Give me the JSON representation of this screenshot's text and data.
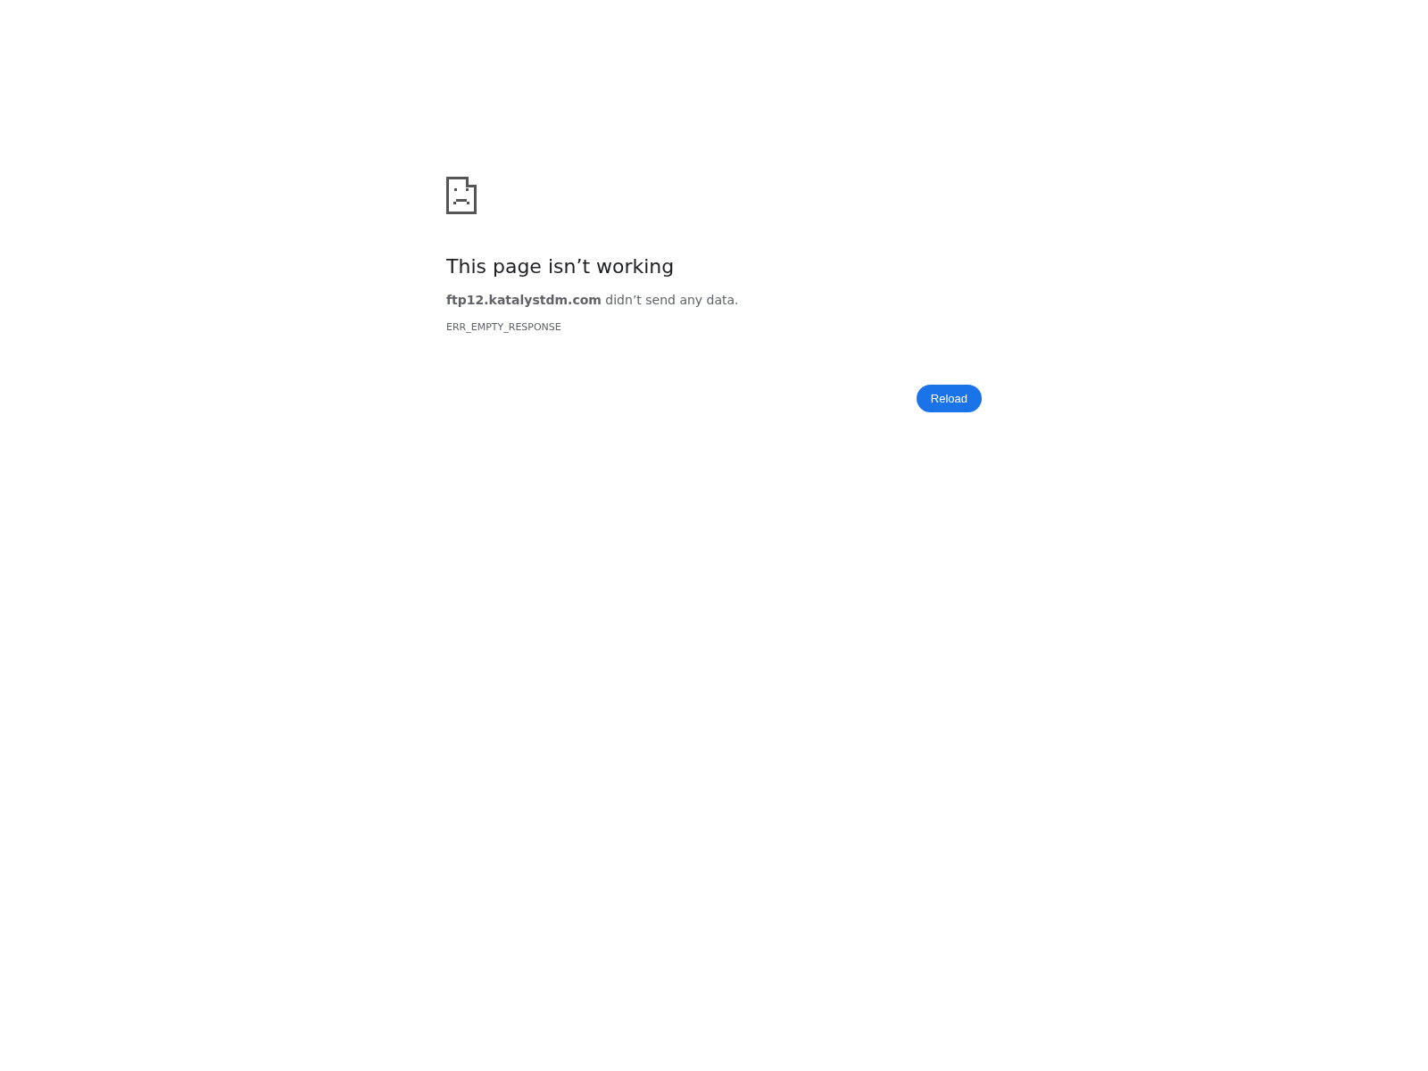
{
  "error_page": {
    "title": "This page isn’t working",
    "message": "**ftp12.katalystdm.com** didn’t send any data.",
    "error_code": "ERR_EMPTY_RESPONSE",
    "buttons": [
      {
        "label": "Reload",
        "kind": "primary"
      }
    ]
  }
}
